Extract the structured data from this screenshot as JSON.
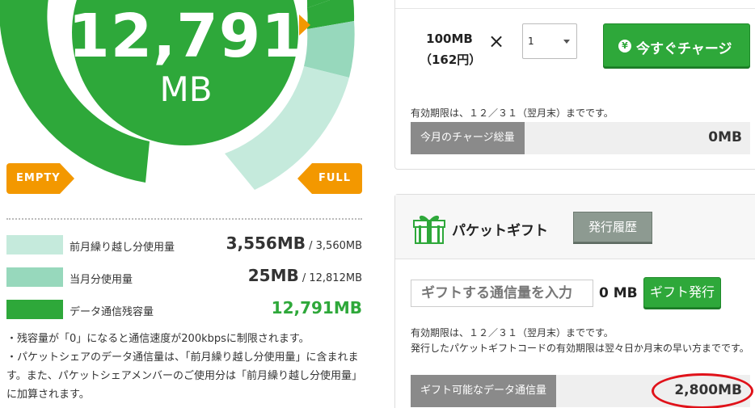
{
  "gauge": {
    "remaining_value": "12,791",
    "remaining_unit": "MB",
    "empty_label": "EMPTY",
    "full_label": "FULL",
    "colors": {
      "remaining": "#2ea83a",
      "carryover": "#c5eadc",
      "current_month": "#97d8bc",
      "accent": "#f39800"
    }
  },
  "legend": [
    {
      "label": "前月繰り越し分使用量",
      "value": "3,556MB",
      "total": " / 3,560MB",
      "color": "#c5eadc"
    },
    {
      "label": "当月分使用量",
      "value": "25MB",
      "total": " / 12,812MB",
      "color": "#97d8bc"
    },
    {
      "label": "データ通信残容量",
      "value": "12,791MB",
      "total": "",
      "color": "#2ea83a"
    }
  ],
  "notes": [
    "・残容量が「0」になると通信速度が200kbpsに制限されます。",
    "・パケットシェアのデータ通信量は、「前月繰り越し分使用量」に含まれます。また、パケットシェアメンバーのご使用分は「前月繰り越し分使用量」に加算されます。"
  ],
  "charge": {
    "amount_line1": "100MB",
    "amount_line2": "（162円）",
    "times_symbol": "×",
    "quantity": "1",
    "charge_button": "今すぐチャージ",
    "yen_icon": "¥",
    "expiry": "有効期限は、１２／３１（翌月末）までです。",
    "monthly_total_label": "今月のチャージ総量",
    "monthly_total_value": "0MB"
  },
  "gift": {
    "title": "パケットギフト",
    "history_button": "発行履歴",
    "input_placeholder": "ギフトする通信量を入力",
    "unit_value": "0 MB",
    "issue_button": "ギフト発行",
    "expiry_line1": "有効期限は、１２／３１（翌月末）までです。",
    "expiry_line2": "発行したパケットギフトコードの有効期限は翌々日か月末の早い方までです。",
    "giftable_label": "ギフト可能なデータ通信量",
    "giftable_value": "2,800MB"
  }
}
